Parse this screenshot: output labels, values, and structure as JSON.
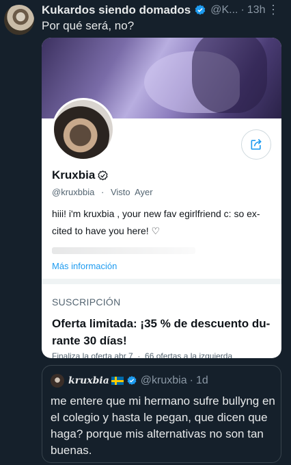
{
  "tweet": {
    "display_name": "Kukardos siendo domados",
    "handle": "@K...",
    "separator": "·",
    "time": "13h",
    "more": "⋮",
    "text": "Por qué será, no?"
  },
  "card": {
    "profile_name": "Kruxbia",
    "handle": "@kruxbbia",
    "meta_separator": "·",
    "last_seen": "Visto  Ayer",
    "bio": "hiii! i'm kruxbia , your new fav egirlfriend c: so ex-cited to have you here! ♡",
    "more_info": "Más información",
    "subscription_label": "SUSCRIPCIÓN",
    "offer_title": "Oferta limitada: ¡35 % de descuento du-rante 30 días!",
    "offer_footer": "Finaliza la oferta abr 7  ·  66 ofertas a la izquierda"
  },
  "quote": {
    "display_name": "kruxbia",
    "handle": "@kruxbia",
    "separator": "·",
    "time": "1d",
    "text": "me entere que mi hermano sufre bullyng en el colegio y hasta le pegan, que dicen que haga? porque mis alternativas no son tan buenas."
  },
  "colors": {
    "background": "#15202b",
    "accent": "#1d9bf0",
    "card_bg": "#ffffff",
    "muted": "#8b98a5"
  },
  "icons": [
    "verified-badge-icon",
    "more-icon",
    "share-icon",
    "verified-outline-icon",
    "swedish-flag-icon"
  ]
}
